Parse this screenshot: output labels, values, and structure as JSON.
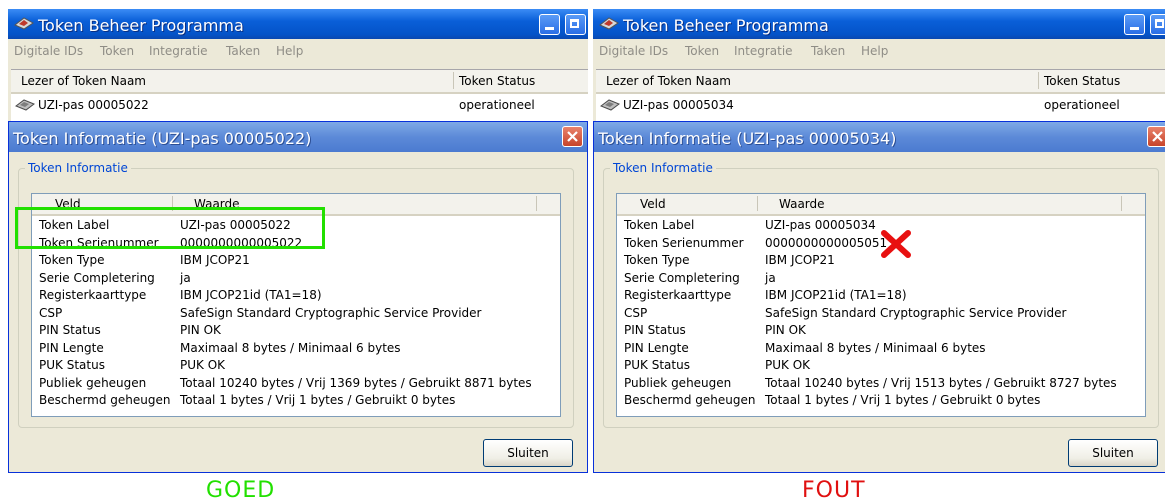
{
  "left": {
    "app_title": "Token Beheer Programma",
    "menu": [
      "Digitale IDs",
      "Token",
      "Integratie",
      "Taken",
      "Help"
    ],
    "list_headers": {
      "name": "Lezer of Token Naam",
      "status": "Token Status"
    },
    "token_row": {
      "name": "UZI-pas 00005022",
      "status": "operationeel"
    },
    "dialog_title": "Token Informatie (UZI-pas 00005022)",
    "group_label": "Token Informatie",
    "columns": {
      "field": "Veld",
      "value": "Waarde"
    },
    "rows": [
      {
        "field": "Token Label",
        "value": "UZI-pas 00005022"
      },
      {
        "field": "Token Serienummer",
        "value": "0000000000005022"
      },
      {
        "field": "Token Type",
        "value": "IBM JCOP21"
      },
      {
        "field": "Serie Completering",
        "value": "ja"
      },
      {
        "field": "Registerkaarttype",
        "value": "IBM JCOP21id (TA1=18)"
      },
      {
        "field": "CSP",
        "value": "SafeSign Standard Cryptographic Service Provider"
      },
      {
        "field": "PIN Status",
        "value": "PIN OK"
      },
      {
        "field": "PIN Lengte",
        "value": "Maximaal 8 bytes / Minimaal 6 bytes"
      },
      {
        "field": "PUK Status",
        "value": "PUK OK"
      },
      {
        "field": "Publiek geheugen",
        "value": "Totaal 10240 bytes / Vrij 1369 bytes / Gebruikt 8871 bytes"
      },
      {
        "field": "Beschermd geheugen",
        "value": "Totaal 1 bytes / Vrij 1 bytes / Gebruikt 0 bytes"
      }
    ],
    "close_button": "Sluiten",
    "caption": "GOED",
    "caption_color": "#22e000",
    "highlight_color": "#22e000"
  },
  "right": {
    "app_title": "Token Beheer Programma",
    "menu": [
      "Digitale IDs",
      "Token",
      "Integratie",
      "Taken",
      "Help"
    ],
    "list_headers": {
      "name": "Lezer of Token Naam",
      "status": "Token Status"
    },
    "token_row": {
      "name": "UZI-pas 00005034",
      "status": "operationeel"
    },
    "dialog_title": "Token Informatie (UZI-pas 00005034)",
    "group_label": "Token Informatie",
    "columns": {
      "field": "Veld",
      "value": "Waarde"
    },
    "rows": [
      {
        "field": "Token Label",
        "value": "UZI-pas 00005034"
      },
      {
        "field": "Token Serienummer",
        "value": "0000000000005051"
      },
      {
        "field": "Token Type",
        "value": "IBM JCOP21"
      },
      {
        "field": "Serie Completering",
        "value": "ja"
      },
      {
        "field": "Registerkaarttype",
        "value": "IBM JCOP21id (TA1=18)"
      },
      {
        "field": "CSP",
        "value": "SafeSign Standard Cryptographic Service Provider"
      },
      {
        "field": "PIN Status",
        "value": "PIN OK"
      },
      {
        "field": "PIN Lengte",
        "value": "Maximaal 8 bytes / Minimaal 6 bytes"
      },
      {
        "field": "PUK Status",
        "value": "PUK OK"
      },
      {
        "field": "Publiek geheugen",
        "value": "Totaal 10240 bytes / Vrij 1513 bytes / Gebruikt 8727 bytes"
      },
      {
        "field": "Beschermd geheugen",
        "value": "Totaal 1 bytes / Vrij 1 bytes / Gebruikt 0 bytes"
      }
    ],
    "close_button": "Sluiten",
    "caption": "FOUT",
    "caption_color": "#e01010",
    "error_mark_color": "#e81010"
  }
}
